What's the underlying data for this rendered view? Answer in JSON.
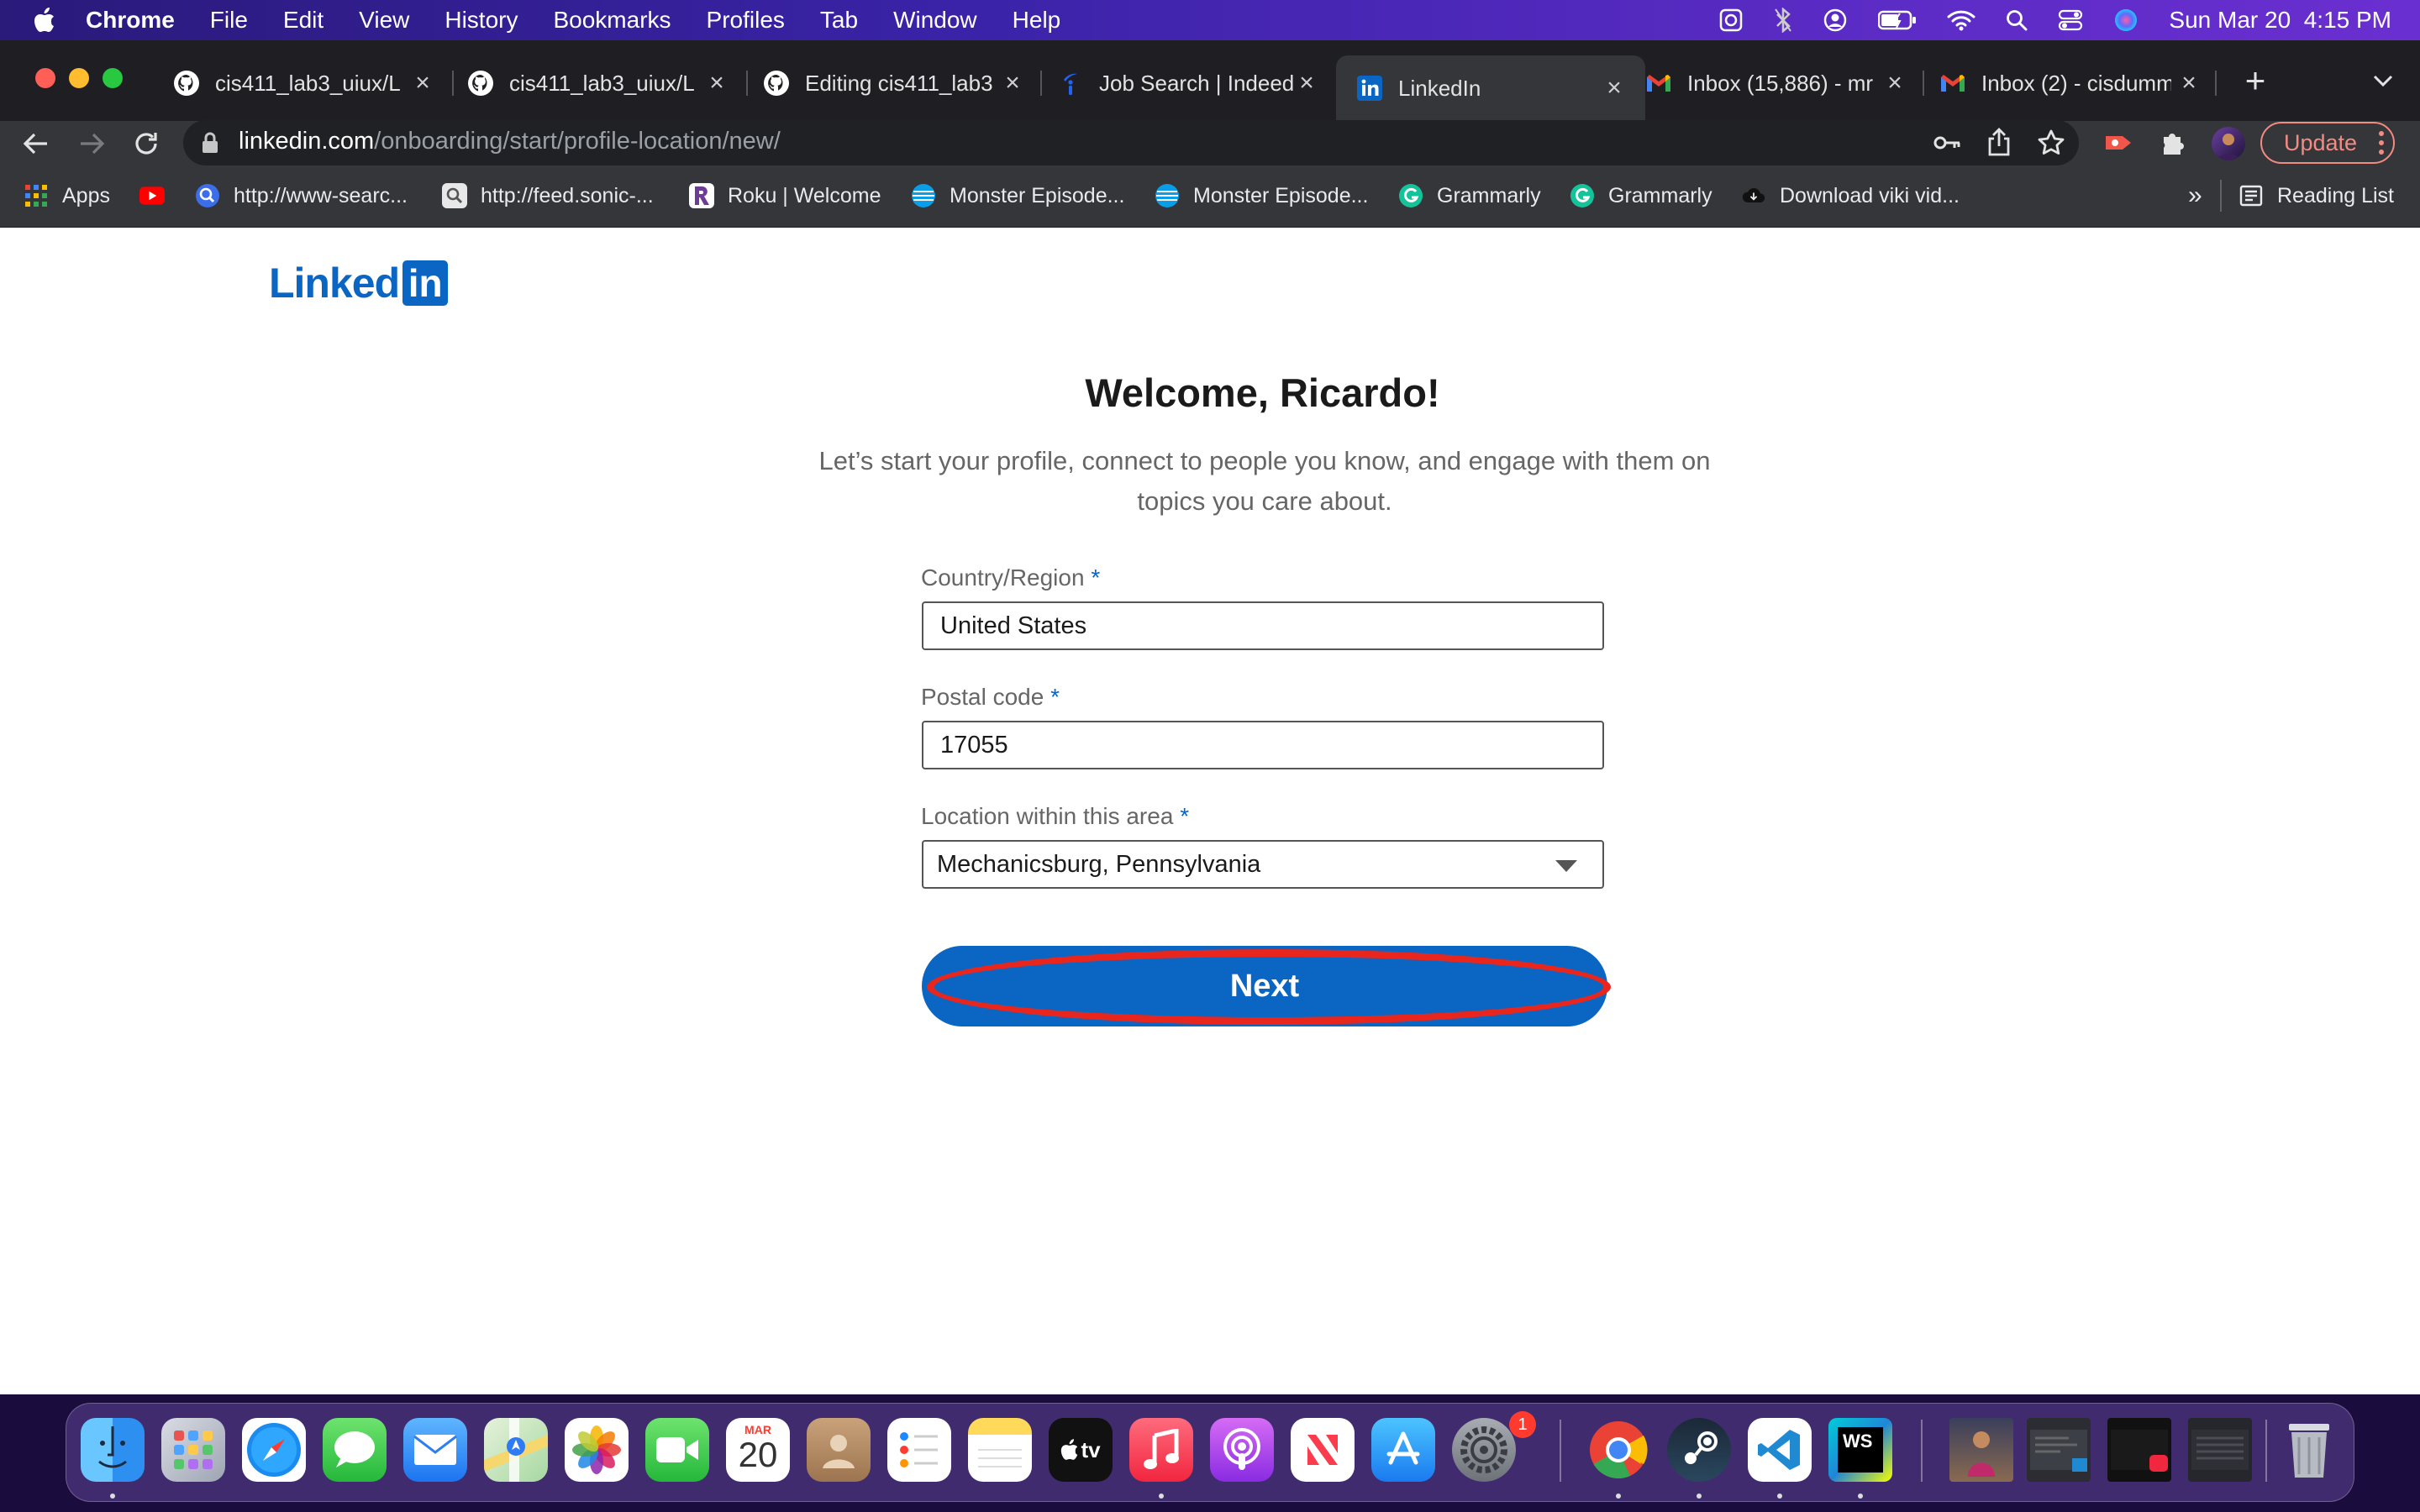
{
  "menubar": {
    "app": "Chrome",
    "items": [
      "File",
      "Edit",
      "View",
      "History",
      "Bookmarks",
      "Profiles",
      "Tab",
      "Window",
      "Help"
    ],
    "datetime": "Sun Mar 20  4:15 PM"
  },
  "tabs": [
    {
      "title": "cis411_lab3_uiux/L",
      "icon": "github-icon"
    },
    {
      "title": "cis411_lab3_uiux/L",
      "icon": "github-icon"
    },
    {
      "title": "Editing cis411_lab3",
      "icon": "github-icon"
    },
    {
      "title": "Job Search | Indeed",
      "icon": "indeed-icon"
    },
    {
      "title": "LinkedIn",
      "icon": "linkedin-icon",
      "active": true
    },
    {
      "title": "Inbox (15,886) - mr",
      "icon": "gmail-icon"
    },
    {
      "title": "Inbox (2) - cisdumm",
      "icon": "gmail-icon"
    }
  ],
  "address": {
    "domain": "linkedin.com",
    "path": "/onboarding/start/profile-location/new/"
  },
  "update_label": "Update",
  "bookmarks": [
    {
      "label": "Apps",
      "icon": "apps-grid-icon"
    },
    {
      "label": "",
      "icon": "youtube-icon"
    },
    {
      "label": "http://www-searc...",
      "icon": "search-globe-icon"
    },
    {
      "label": "http://feed.sonic-...",
      "icon": "magnifier-icon"
    },
    {
      "label": "Roku | Welcome",
      "icon": "roku-icon"
    },
    {
      "label": "Monster Episode...",
      "icon": "att-icon"
    },
    {
      "label": "Monster Episode...",
      "icon": "att-icon"
    },
    {
      "label": "Grammarly",
      "icon": "grammarly-icon"
    },
    {
      "label": "Grammarly",
      "icon": "grammarly-icon"
    },
    {
      "label": "Download viki vid...",
      "icon": "cloud-download-icon"
    }
  ],
  "reading_list": "Reading List",
  "page": {
    "logo_text": "Linked",
    "logo_box": "in",
    "heading": "Welcome, Ricardo!",
    "subtitle": "Let’s start your profile, connect to people you know, and engage with them on topics you care about.",
    "country_label": "Country/Region",
    "country_value": "United States",
    "postal_label": "Postal code",
    "postal_value": "17055",
    "location_label": "Location within this area",
    "location_value": "Mechanicsburg, Pennsylvania",
    "required_mark": "*",
    "next_label": "Next"
  },
  "dock": {
    "calendar_month": "MAR",
    "calendar_day": "20",
    "settings_badge": "1",
    "tv_label": "tv",
    "ws_label": "WS"
  },
  "colors": {
    "linkedin_blue": "#0a66c2",
    "highlight_red": "#e8261e"
  }
}
